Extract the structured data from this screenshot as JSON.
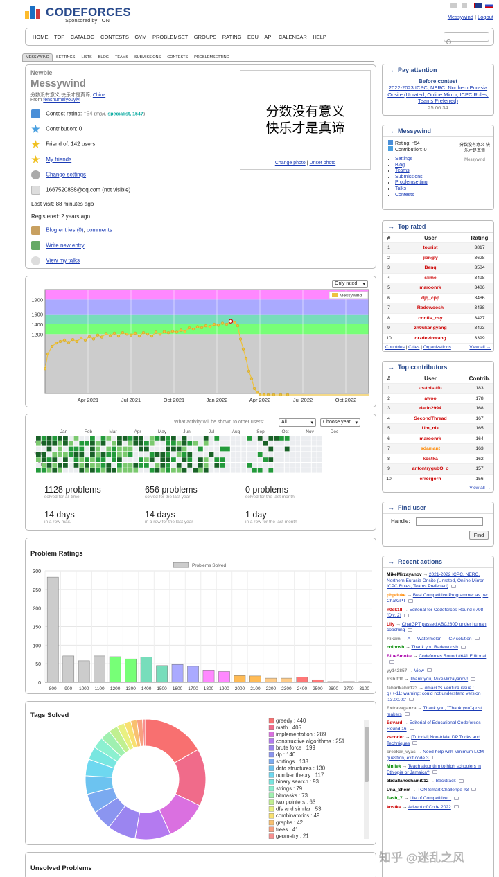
{
  "brand": {
    "name": "CODEFORCES",
    "sponsor": "Sponsored by TON"
  },
  "header": {
    "user": "Messywind",
    "logout": "Logout"
  },
  "nav": [
    "HOME",
    "TOP",
    "CATALOG",
    "CONTESTS",
    "GYM",
    "PROBLEMSET",
    "GROUPS",
    "RATING",
    "EDU",
    "API",
    "CALENDAR",
    "HELP"
  ],
  "subtabs": [
    "MESSYWIND",
    "SETTINGS",
    "LISTS",
    "BLOG",
    "TEAMS",
    "SUBMISSIONS",
    "CONTESTS",
    "PROBLEMSETTING"
  ],
  "profile": {
    "rank": "Newbie",
    "handle": "Messywind",
    "motto": "分数没有意义 快乐才是真谛,",
    "country": "China",
    "from_label": "From",
    "from": "fenshumeiyouyiyi",
    "rating_label": "Contest rating:",
    "rating": "⁻54",
    "max": "(max. ",
    "max_rank": "specialist, 1547",
    "max_close": ")",
    "contribution": "Contribution: 0",
    "friend": "Friend of: 142 users",
    "my_friends": "My friends",
    "change_settings": "Change settings",
    "email": "1667520858@qq.com (not visible)",
    "last_visit": "Last visit: 88 minutes ago",
    "registered": "Registered: 2 years ago",
    "blog": "Blog entries (0)",
    "comments": "comments",
    "write": "Write new entry",
    "talks": "View my talks",
    "photo_line1": "分数没有意义",
    "photo_line2": "快乐才是真谛",
    "change_photo": "Change photo",
    "unset_photo": "Unset photo"
  },
  "rating_chart": {
    "select": "Only rated",
    "legend": "Messywind",
    "y_ticks": [
      "1900",
      "1600",
      "1400",
      "1200"
    ],
    "x_ticks": [
      "Apr 2021",
      "Jul 2021",
      "Oct 2021",
      "Jan 2022",
      "Apr 2022",
      "Jul 2022",
      "Oct 2022"
    ]
  },
  "activity": {
    "question": "What activity will be shown to other users:",
    "visibility": "All",
    "year": "Choose year",
    "months": [
      "Jan",
      "Feb",
      "Mar",
      "Apr",
      "May",
      "Jun",
      "Jul",
      "Aug",
      "Sep",
      "Oct",
      "Nov",
      "Dec"
    ],
    "days": [
      "Mon",
      "Wed",
      "Fri"
    ],
    "stats": [
      {
        "big": "1128 problems",
        "small": "solved for all time"
      },
      {
        "big": "656 problems",
        "small": "solved for the last year"
      },
      {
        "big": "0 problems",
        "small": "solved for the last month"
      },
      {
        "big": "14 days",
        "small": "in a row max."
      },
      {
        "big": "14 days",
        "small": "in a row for the last year"
      },
      {
        "big": "1 day",
        "small": "in a row for the last month"
      }
    ]
  },
  "chart_data": [
    {
      "type": "bar",
      "title": "Problem Ratings",
      "legend": "Problems Solved",
      "categories": [
        "800",
        "900",
        "1000",
        "1100",
        "1200",
        "1300",
        "1400",
        "1500",
        "1600",
        "1700",
        "1800",
        "1900",
        "2000",
        "2100",
        "2200",
        "2300",
        "2400",
        "2500",
        "2600",
        "2700",
        "3100"
      ],
      "values": [
        283,
        71,
        58,
        71,
        69,
        63,
        68,
        45,
        48,
        43,
        33,
        29,
        18,
        17,
        11,
        11,
        14,
        7,
        2,
        2,
        2
      ],
      "ylim": [
        0,
        300
      ],
      "y_ticks": [
        "300",
        "250",
        "200",
        "150",
        "100",
        "50",
        "0"
      ],
      "colors": [
        "#cccccc",
        "#cccccc",
        "#cccccc",
        "#cccccc",
        "#77ff77",
        "#77ff77",
        "#77ddbb",
        "#77ddbb",
        "#aaaaff",
        "#aaaaff",
        "#ff88ff",
        "#ff88ff",
        "#ffbb55",
        "#ffbb55",
        "#ffcc88",
        "#ffcc88",
        "#ff7777",
        "#ff7777",
        "#ff3333",
        "#ff3333",
        "#aa0000"
      ]
    },
    {
      "type": "pie",
      "title": "Tags Solved",
      "labels": [
        "greedy",
        "math",
        "implementation",
        "constructive algorithms",
        "brute force",
        "dp",
        "sortings",
        "data structures",
        "number theory",
        "binary search",
        "strings",
        "bitmasks",
        "two pointers",
        "dfs and similar",
        "combinatorics",
        "graphs",
        "trees",
        "geometry"
      ],
      "values": [
        440,
        405,
        289,
        251,
        199,
        140,
        138,
        130,
        117,
        93,
        79,
        73,
        63,
        53,
        49,
        42,
        41,
        21
      ],
      "legend_text": [
        "greedy : 440",
        "math : 405",
        "implementation : 289",
        "constructive algorithms : 251",
        "brute force : 199",
        "dp : 140",
        "sortings : 138",
        "data structures : 130",
        "number theory : 117",
        "binary search : 93",
        "strings : 79",
        "bitmasks : 73",
        "two pointers : 63",
        "dfs and similar : 53",
        "combinatorics : 49",
        "graphs : 42",
        "trees : 41",
        "geometry : 21"
      ],
      "colors": [
        "#f87070",
        "#f06b8a",
        "#da70e0",
        "#b47af0",
        "#9b85f0",
        "#8b95f0",
        "#7aaaf0",
        "#6cc3f0",
        "#6ed8f0",
        "#78e6e0",
        "#8cf0d0",
        "#a0f0b0",
        "#c0f090",
        "#e8f080",
        "#f8e070",
        "#f8c070",
        "#f8a080",
        "#f89090"
      ]
    }
  ],
  "unsolved_title": "Unsolved Problems",
  "pay_attention": {
    "title": "Pay attention",
    "before": "Before contest",
    "contest": "2022-2023 ICPC, NERC, Northern Eurasia Onsite (Unrated, Online Mirror, ICPC Rules, Teams Preferred)",
    "timer": "25:06:34"
  },
  "user_box": {
    "title": "Messywind",
    "rating": "Rating: ⁻54",
    "contribution": "Contribution: 0",
    "motto": "分数没有意义 快乐才是真谛",
    "name": "Messywind",
    "links": [
      "Settings",
      "Blog",
      "Teams",
      "Submissions",
      "Problemsetting",
      "Talks",
      "Contests"
    ]
  },
  "top_rated": {
    "title": "Top rated",
    "headers": [
      "#",
      "User",
      "Rating"
    ],
    "rows": [
      [
        "1",
        "tourist",
        "3817"
      ],
      [
        "2",
        "jiangly",
        "3628"
      ],
      [
        "3",
        "Benq",
        "3584"
      ],
      [
        "4",
        "slime",
        "3498"
      ],
      [
        "5",
        "maroonrk",
        "3486"
      ],
      [
        "6",
        "djq_cpp",
        "3486"
      ],
      [
        "7",
        "Radewoosh",
        "3438"
      ],
      [
        "8",
        "cnnfls_csy",
        "3427"
      ],
      [
        "9",
        "zh0ukangyang",
        "3423"
      ],
      [
        "10",
        "orzdevinwang",
        "3399"
      ]
    ],
    "footer": [
      "Countries",
      "Cities",
      "Organizations"
    ],
    "view_all": "View all →"
  },
  "top_contrib": {
    "title": "Top contributors",
    "headers": [
      "#",
      "User",
      "Contrib."
    ],
    "rows": [
      [
        "1",
        "-is-this-fft-",
        "183"
      ],
      [
        "2",
        "awoo",
        "178"
      ],
      [
        "3",
        "dario2994",
        "168"
      ],
      [
        "4",
        "SecondThread",
        "167"
      ],
      [
        "5",
        "Um_nik",
        "165"
      ],
      [
        "6",
        "maroonrk",
        "164"
      ],
      [
        "7",
        "adamant",
        "163"
      ],
      [
        "8",
        "kostka",
        "162"
      ],
      [
        "9",
        "antontrygubO_o",
        "157"
      ],
      [
        "10",
        "errorgorn",
        "156"
      ]
    ],
    "view_all": "View all →"
  },
  "find_user": {
    "title": "Find user",
    "label": "Handle:",
    "button": "Find"
  },
  "recent": {
    "title": "Recent actions",
    "items": [
      {
        "user": "MikeMirzayanov",
        "text": "2021-2022 ICPC, NERC, Northern Eurasia Onsite (Unrated, Online Mirror, ICPC Rules, Teams Preferred)"
      },
      {
        "user": "phpduke",
        "text": "Best Competitive Programmer as per ChatGPT"
      },
      {
        "user": "n0sk1ll",
        "text": "Editorial for Codeforces Round #798 (Div. 2)"
      },
      {
        "user": "Lily",
        "text": "ChatGPT passed ABC280D under human coaching"
      },
      {
        "user": "Rikam",
        "text": "A — Watermelon — C# solution"
      },
      {
        "user": "colposh",
        "text": "Thank you Radewoosh"
      },
      {
        "user": "BlueSmoke",
        "text": "Codeforces Round #641 Editorial"
      },
      {
        "user": "yy142857",
        "text": "View"
      },
      {
        "user": "Rshitttt",
        "text": "Thank you, MikeMirzayanov!"
      },
      {
        "user": "fahadkabir123",
        "text": "#macOS Ventura issue : g++-11: warning: could not understand version '13.00.00'"
      },
      {
        "user": "Extravaganza",
        "text": "Thank you, \"Thank you\"-post makers"
      },
      {
        "user": "Edvard",
        "text": "Editorial of Educational Codeforces Round 16"
      },
      {
        "user": "zscoder",
        "text": "[Tutorial] Non-trivial DP Tricks and Techniques"
      },
      {
        "user": "sreekar_vyas",
        "text": "Need help with Minimum LCM question, exit code 3."
      },
      {
        "user": "Mnilek",
        "text": "Teach algorithm to high schoolers in Ethiopia or Jamaica?"
      },
      {
        "user": "abdallaheshami012",
        "text": "Backtrack"
      },
      {
        "user": "Una_Shem",
        "text": "TON Smart Challenge #3"
      },
      {
        "user": "flash_7",
        "text": "Life of Competitive..."
      },
      {
        "user": "kostka",
        "text": "Advent of Code 2022"
      }
    ]
  },
  "watermark": "知乎 @迷乱之风",
  "colors": {
    "accent": "#2a4b8d",
    "link": "#1a3bb5",
    "red": "#cc0000",
    "orange": "#ff8800"
  }
}
